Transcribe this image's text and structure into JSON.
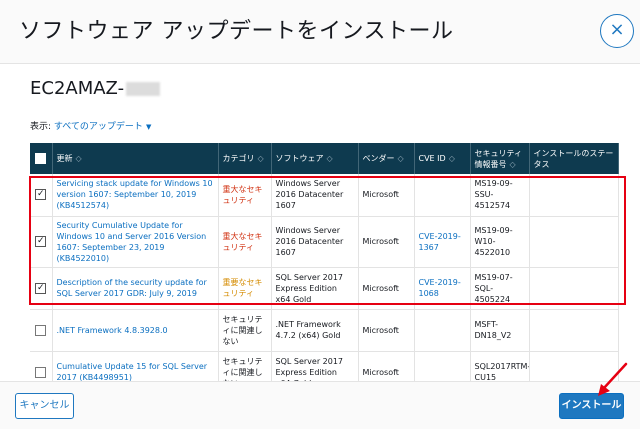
{
  "dialog": {
    "title": "ソフトウェア アップデートをインストール",
    "close_label": "×"
  },
  "instance": {
    "name": "EC2AMAZ-"
  },
  "filter": {
    "label": "表示:",
    "value": "すべてのアップデート",
    "caret": "▼"
  },
  "table": {
    "sort_glyph": "◇",
    "columns": [
      "更新",
      "カテゴリ",
      "ソフトウェア",
      "ベンダー",
      "CVE ID",
      "セキュリティ情報番号",
      "インストールのステータス"
    ],
    "rows": [
      {
        "checked": true,
        "update": "Servicing stack update for Windows 10 version 1607: September 10, 2019 (KB4512574)",
        "category": "重大なセキュリティ",
        "category_level": "critical",
        "software": "Windows Server 2016 Datacenter 1607",
        "vendor": "Microsoft",
        "cve": "",
        "bulletin": "MS19-09-SSU-4512574",
        "status": ""
      },
      {
        "checked": true,
        "update": "Security Cumulative Update for Windows 10 and Server 2016 Version 1607: September 23, 2019 (KB4522010)",
        "category": "重大なセキュリティ",
        "category_level": "critical",
        "software": "Windows Server 2016 Datacenter 1607",
        "vendor": "Microsoft",
        "cve": "CVE-2019-1367",
        "bulletin": "MS19-09-W10-4522010",
        "status": ""
      },
      {
        "checked": true,
        "update": "Description of the security update for SQL Server 2017 GDR: July 9, 2019",
        "category": "重要なセキュリティ",
        "category_level": "important",
        "software": "SQL Server 2017 Express Edition x64 Gold",
        "vendor": "Microsoft",
        "cve": "CVE-2019-1068",
        "bulletin": "MS19-07-SQL-4505224",
        "status": ""
      },
      {
        "checked": false,
        "update": ".NET Framework 4.8.3928.0",
        "category": "セキュリティに関連しない",
        "category_level": "none",
        "software": ".NET Framework 4.7.2 (x64) Gold",
        "vendor": "Microsoft",
        "cve": "",
        "bulletin": "MSFT-DN18_V2",
        "status": ""
      },
      {
        "checked": false,
        "update": "Cumulative Update 15 for SQL Server 2017 (KB4498951)",
        "category": "セキュリティに関連しない",
        "category_level": "none",
        "software": "SQL Server 2017 Express Edition x64 Gold",
        "vendor": "Microsoft",
        "cve": "",
        "bulletin": "SQL2017RTM-CU15",
        "status": ""
      }
    ]
  },
  "footer": {
    "cancel_label": "キャンセル",
    "install_label": "インストール"
  },
  "colors": {
    "header_bg": "#0e3a4f",
    "accent": "#1f78c0",
    "link": "#0b6fc0",
    "critical": "#d13212",
    "important": "#d48b00",
    "highlight": "#e60012"
  }
}
